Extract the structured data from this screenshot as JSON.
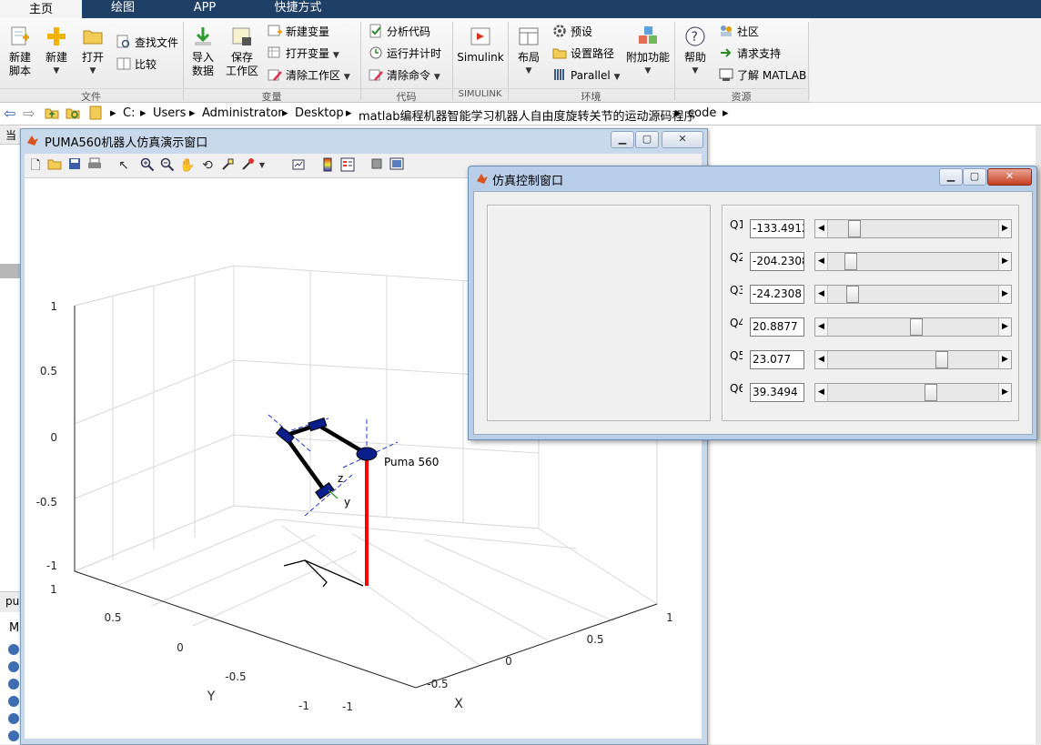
{
  "ribbon": {
    "tabs": [
      {
        "label": "主页",
        "active": true
      },
      {
        "label": "绘图",
        "active": false
      },
      {
        "label": "APP",
        "active": false
      },
      {
        "label": "快捷方式",
        "active": false
      }
    ],
    "file": {
      "new_script": [
        "新建",
        "脚本"
      ],
      "new": "新建",
      "open": "打开",
      "find_files": "查找文件",
      "compare": "比较",
      "group": "文件"
    },
    "variable": {
      "import": [
        "导入",
        "数据"
      ],
      "save": [
        "保存",
        "工作区"
      ],
      "new_variable": "新建变量",
      "open_variable": "打开变量",
      "clear_workspace": "清除工作区",
      "group": "变量"
    },
    "code": {
      "analyze": "分析代码",
      "run_time": "运行并计时",
      "clear_commands": "清除命令",
      "group": "代码"
    },
    "simulink": {
      "label": "Simulink",
      "group": "SIMULINK"
    },
    "environment": {
      "layout": "布局",
      "preferences": "预设",
      "set_path": "设置路径",
      "parallel": "Parallel",
      "addons": "附加功能",
      "group": "环境"
    },
    "resources": {
      "help": "帮助",
      "community": "社区",
      "support": "请求支持",
      "learn": "了解 MATLAB",
      "group": "资源"
    }
  },
  "address": {
    "crumbs": [
      "C:",
      "Users",
      "Administrator",
      "Desktop",
      "matlab编程机器智能学习机器人自由度旋转关节的运动源码程序",
      "code"
    ]
  },
  "background": {
    "left_label_1": "当",
    "left_label_2": "pu",
    "left_label_3": "M"
  },
  "figure_window": {
    "title": "PUMA560机器人仿真演示窗口",
    "robot_label": "Puma 560",
    "frame_z": "z",
    "frame_y": "y",
    "axis_x_label": "X",
    "axis_y_label": "Y",
    "z_ticks": [
      "1",
      "0.5",
      "0",
      "-0.5",
      "-1"
    ],
    "y_ticks": [
      "1",
      "0.5",
      "0",
      "-0.5",
      "-1"
    ],
    "x_ticks": [
      "-1",
      "-0.5",
      "0",
      "0.5",
      "1"
    ]
  },
  "control_window": {
    "title": "仿真控制窗口",
    "joints": [
      {
        "label": "Q1",
        "value": "-133.4912",
        "slider_fraction": 0.13
      },
      {
        "label": "Q2",
        "value": "-204.2308",
        "slider_fraction": 0.11
      },
      {
        "label": "Q3",
        "value": "-24.2308",
        "slider_fraction": 0.12
      },
      {
        "label": "Q4",
        "value": "20.8877",
        "slider_fraction": 0.52
      },
      {
        "label": "Q5",
        "value": "23.077",
        "slider_fraction": 0.68
      },
      {
        "label": "Q6",
        "value": "39.3494",
        "slider_fraction": 0.61
      }
    ]
  },
  "colors": {
    "tabbar": "#1e3f66",
    "link_red": "#ff0000",
    "link_black": "#000000",
    "joint_blue": "#0a1e8c"
  }
}
